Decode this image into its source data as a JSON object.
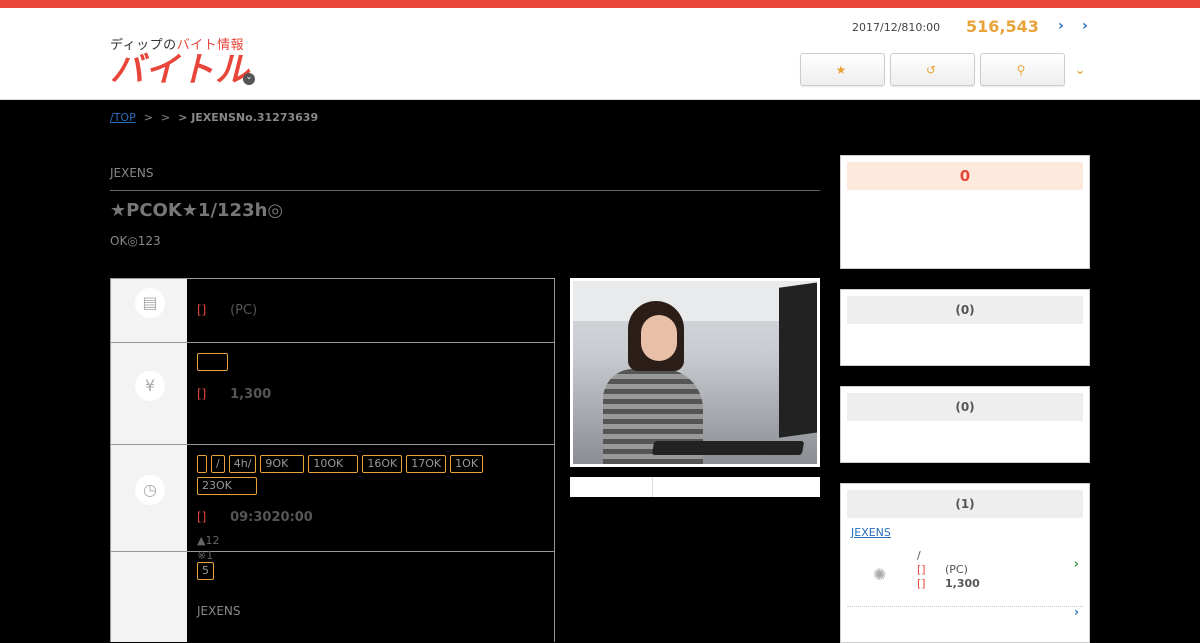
{
  "header": {
    "logo_sub_pre": "ディップの",
    "logo_sub_red": "バイト情報",
    "logo_main": "バイトル",
    "date": "2017/12/810:00",
    "count": "516,543",
    "arrow1": "›",
    "arrow2": "›",
    "buttons": [
      {
        "icon": "★",
        "label": ""
      },
      {
        "icon": "↺",
        "label": ""
      },
      {
        "icon": "⚲",
        "label": ""
      }
    ],
    "chevron": "⌄"
  },
  "breadcrumb": {
    "top": "/TOP",
    "sep1": ">",
    "sep2": ">",
    "current": "> JEXENSNo.31273639"
  },
  "job": {
    "company": "JEXENS",
    "title": "★PCOK★1/123h◎",
    "subtitle": "OK◎123",
    "rows": [
      {
        "icon": "briefcase-icon",
        "glyph": "▤",
        "label": "[]",
        "value": "(PC)"
      },
      {
        "icon": "yen-icon",
        "glyph": "¥",
        "tag": "",
        "label": "[]",
        "value": "1,300"
      },
      {
        "icon": "clock-icon",
        "glyph": "◷",
        "tags": [
          "",
          "/",
          "4h/",
          "9OK",
          "10OK",
          "16OK",
          "17OK",
          "1OK",
          "23OK"
        ],
        "label": "[]",
        "value": "09:3020:00",
        "notes": [
          "▲12",
          "※1"
        ]
      },
      {
        "icon": "badge-icon",
        "glyph": "",
        "tag": "5",
        "company": "JEXENS"
      }
    ]
  },
  "sidebar": {
    "box1": {
      "count": "0"
    },
    "box2": {
      "title": "(0)"
    },
    "box3": {
      "title": "(0)"
    },
    "box4": {
      "title": "(1)",
      "link": "JEXENS",
      "item": {
        "line1": "/",
        "label1": "[]",
        "value1": "(PC)",
        "label2": "[]",
        "value2": "1,300"
      }
    }
  },
  "colors": {
    "accent": "#e8463a",
    "highlight": "#e8a33a",
    "link": "#2a6ebb"
  }
}
